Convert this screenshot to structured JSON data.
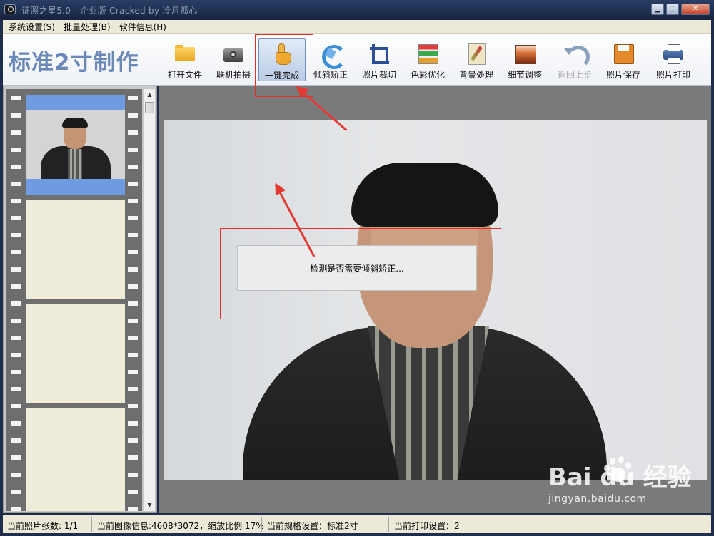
{
  "window": {
    "title": "证照之星5.0 - 企业版 Cracked by 冷月孤心",
    "buttons": {
      "minimize": "▁",
      "maximize": "□",
      "close": "✕"
    }
  },
  "menu": [
    {
      "label": "系统设置(S)"
    },
    {
      "label": "批量处理(B)"
    },
    {
      "label": "软件信息(H)"
    }
  ],
  "brand": "标准2寸制作",
  "toolbar": [
    {
      "label": "打开文件",
      "icon": "folder-icon"
    },
    {
      "label": "联机拍摄",
      "icon": "camera-icon"
    },
    {
      "label": "一键完成",
      "icon": "hand-click-icon",
      "active": true
    },
    {
      "label": "倾斜矫正",
      "icon": "rotate-icon"
    },
    {
      "label": "照片裁切",
      "icon": "crop-icon"
    },
    {
      "label": "色彩优化",
      "icon": "color-bars-icon"
    },
    {
      "label": "背景处理",
      "icon": "brush-icon"
    },
    {
      "label": "细节调整",
      "icon": "histogram-icon"
    },
    {
      "label": "返回上步",
      "icon": "undo-icon",
      "disabled": true
    },
    {
      "label": "照片保存",
      "icon": "floppy-save-icon"
    },
    {
      "label": "照片打印",
      "icon": "printer-icon"
    }
  ],
  "dialog": {
    "message": "检测是否需要倾斜矫正..."
  },
  "status": {
    "count": "当前照片张数: 1/1",
    "image_info": "当前图像信息:4608*3072，缩放比例 17%",
    "spec": "当前规格设置：标准2寸",
    "print": "当前打印设置：2"
  },
  "watermark": {
    "main": "Bai du 经验",
    "sub": "jingyan.baidu.com"
  },
  "colors": {
    "annotation": "#e23a33",
    "brand": "#6a88b8",
    "selected_frame": "#6f9ce0"
  }
}
